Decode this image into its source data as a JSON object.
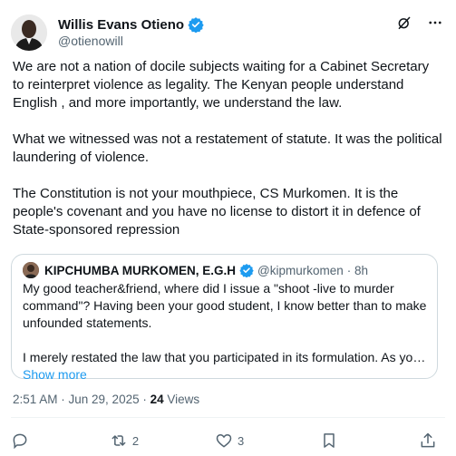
{
  "author": {
    "name": "Willis Evans Otieno",
    "handle": "@otienowill",
    "verified_color": "#1d9bf0"
  },
  "tweet": {
    "paragraphs": [
      "We are not a nation of docile subjects waiting for a Cabinet Secretary to reinterpret violence as legality. The Kenyan people understand English , and more importantly, we understand the law.",
      "What we witnessed was not a restatement of statute. It was the political laundering of violence.",
      "The Constitution is not your mouthpiece, CS Murkomen. It is the people's covenant and you have no license to distort it in defence of State-sponsored repression"
    ]
  },
  "quoted": {
    "name": "KIPCHUMBA MURKOMEN, E.G.H",
    "handle": "@kipmurkomen",
    "time": "· 8h",
    "paragraphs": [
      "My good teacher&friend, where did I issue a \"shoot -live to murder command\"? Having been your good student, I know better than to make unfounded statements.",
      "I merely restated  the law that you participated in its formulation. As you may..."
    ],
    "show_more": "Show more"
  },
  "meta": {
    "timestamp": "2:51 AM · Jun 29, 2025 · ",
    "views_count": "24",
    "views_label": " Views"
  },
  "actions": {
    "reply": "",
    "retweet": "2",
    "like": "3",
    "bookmark": "",
    "share": ""
  },
  "icons": {
    "top": [
      "grok-icon",
      "more-icon"
    ],
    "actions": [
      "reply-icon",
      "retweet-icon",
      "like-icon",
      "bookmark-icon",
      "share-icon"
    ]
  }
}
